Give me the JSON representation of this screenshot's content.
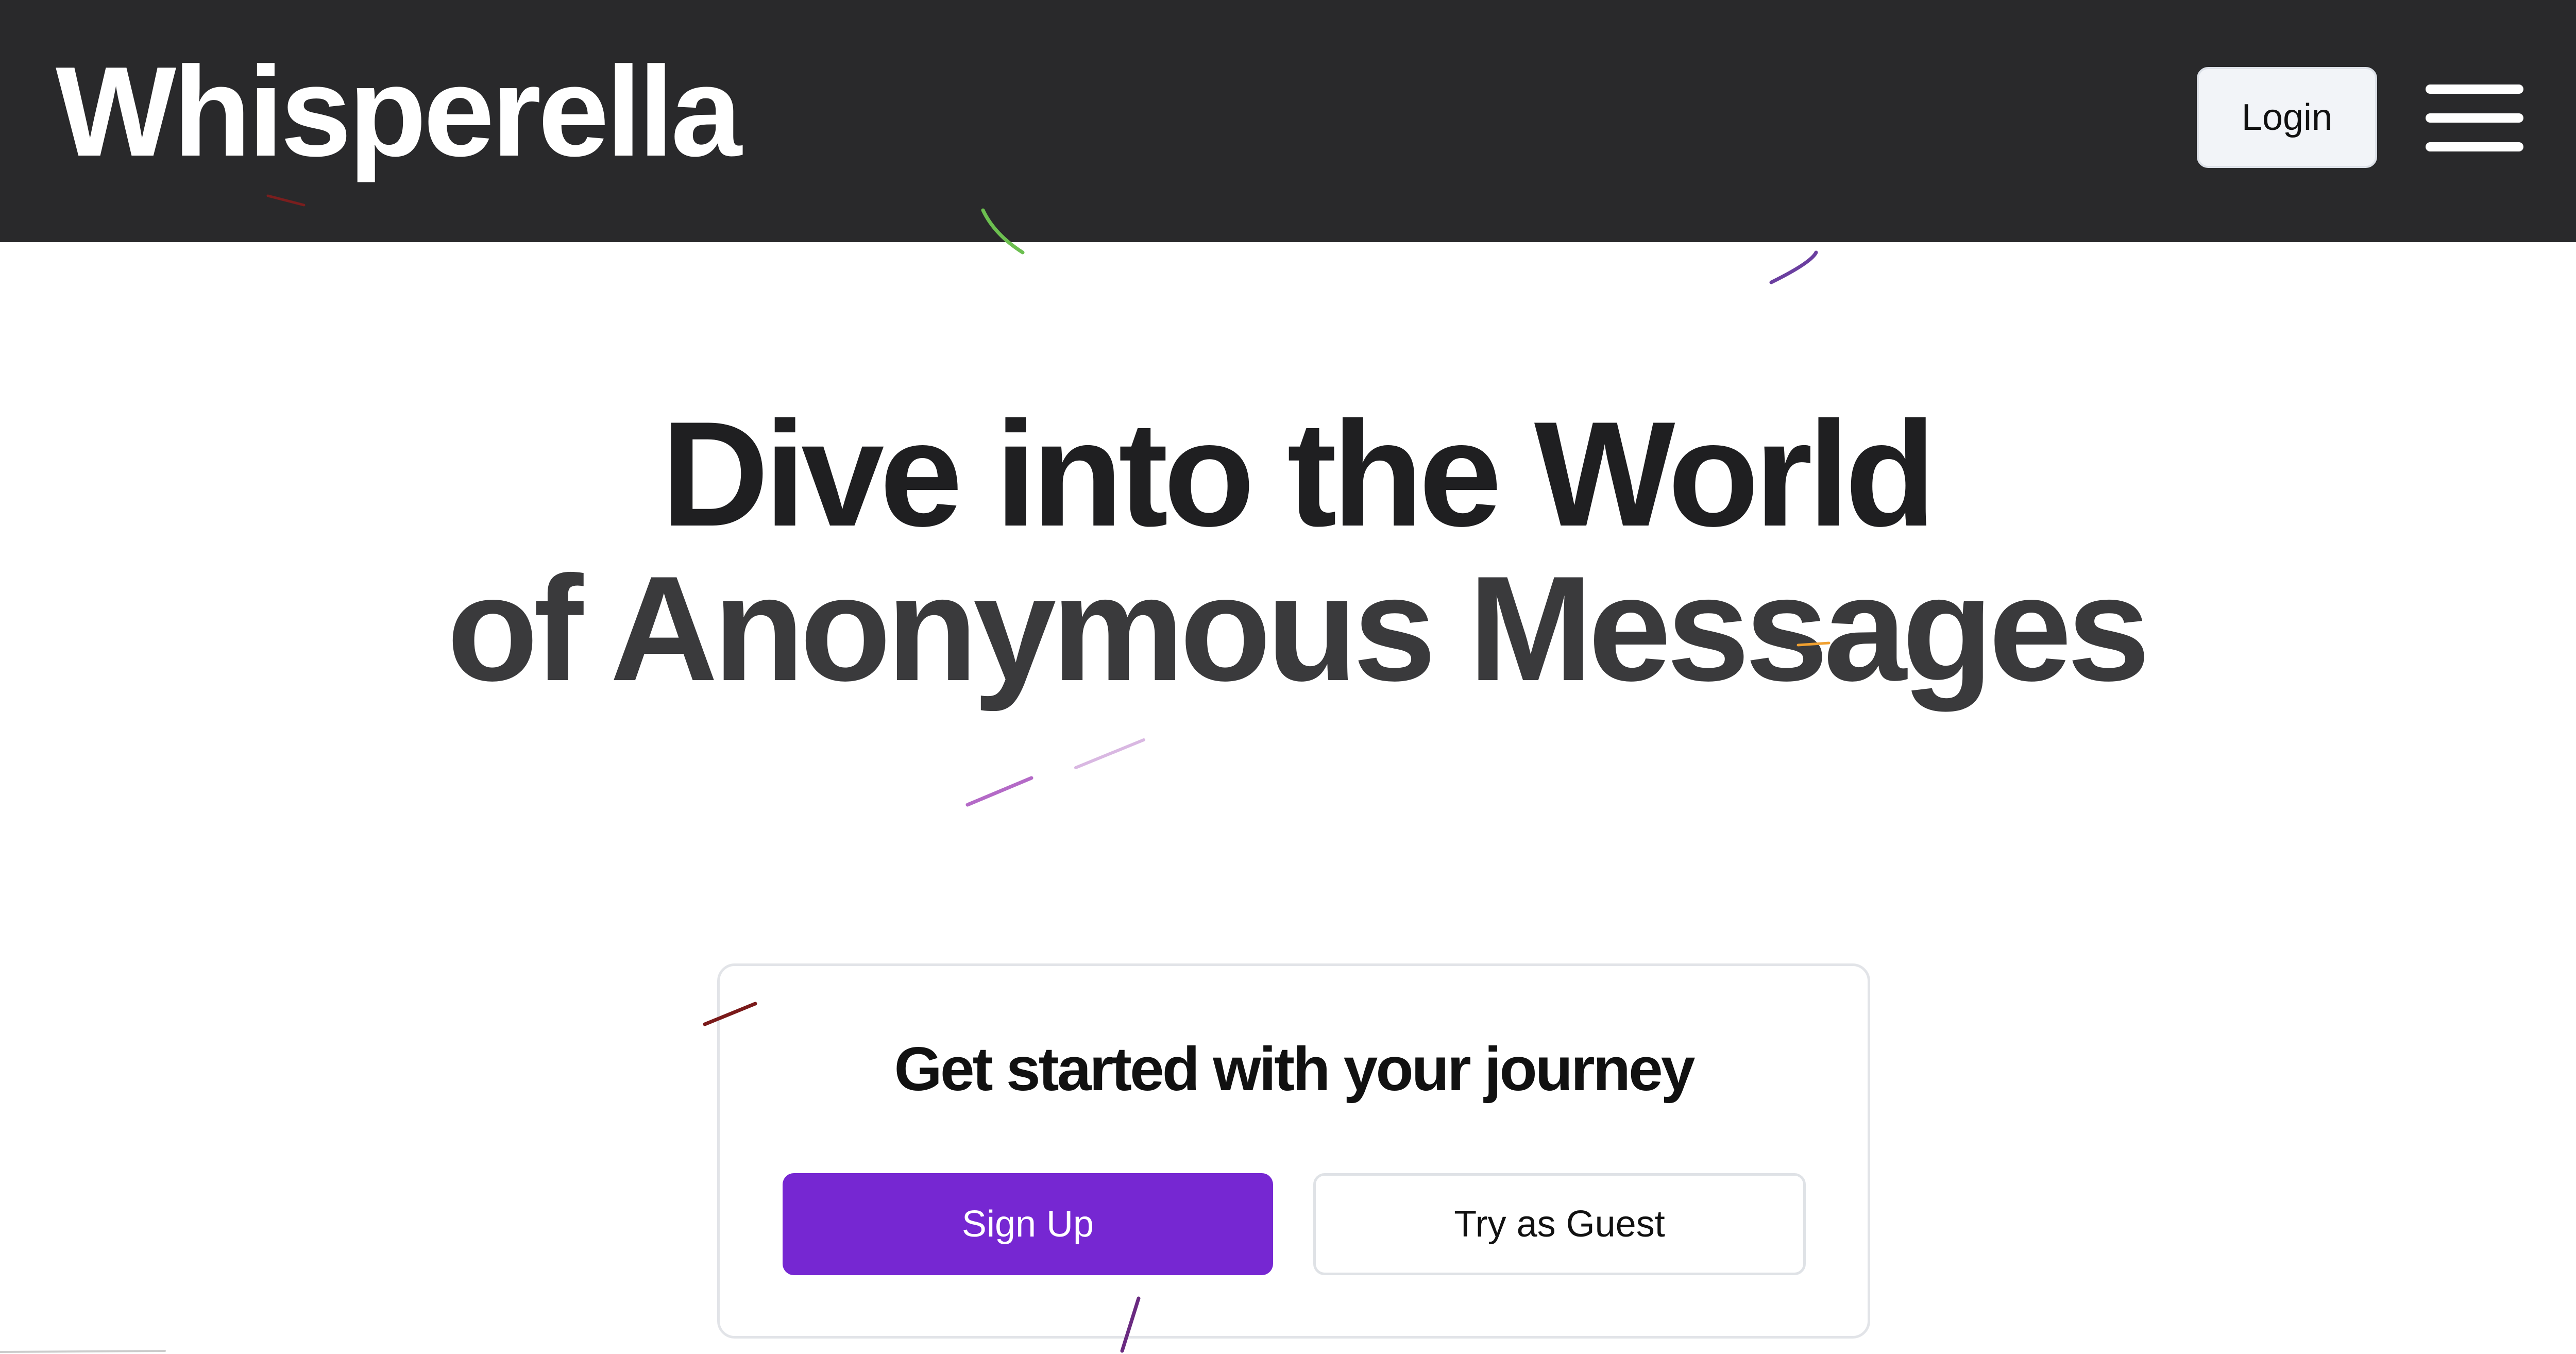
{
  "header": {
    "brand": "Whisperella",
    "login_label": "Login"
  },
  "hero": {
    "line1": "Dive into the World",
    "line2": "of Anonymous Messages"
  },
  "card": {
    "title": "Get started with your journey",
    "signup_label": "Sign Up",
    "guest_label": "Try as Guest"
  },
  "colors": {
    "header_bg": "#29292b",
    "primary": "#7627d2"
  },
  "icons": {
    "menu": "hamburger-menu-icon"
  }
}
